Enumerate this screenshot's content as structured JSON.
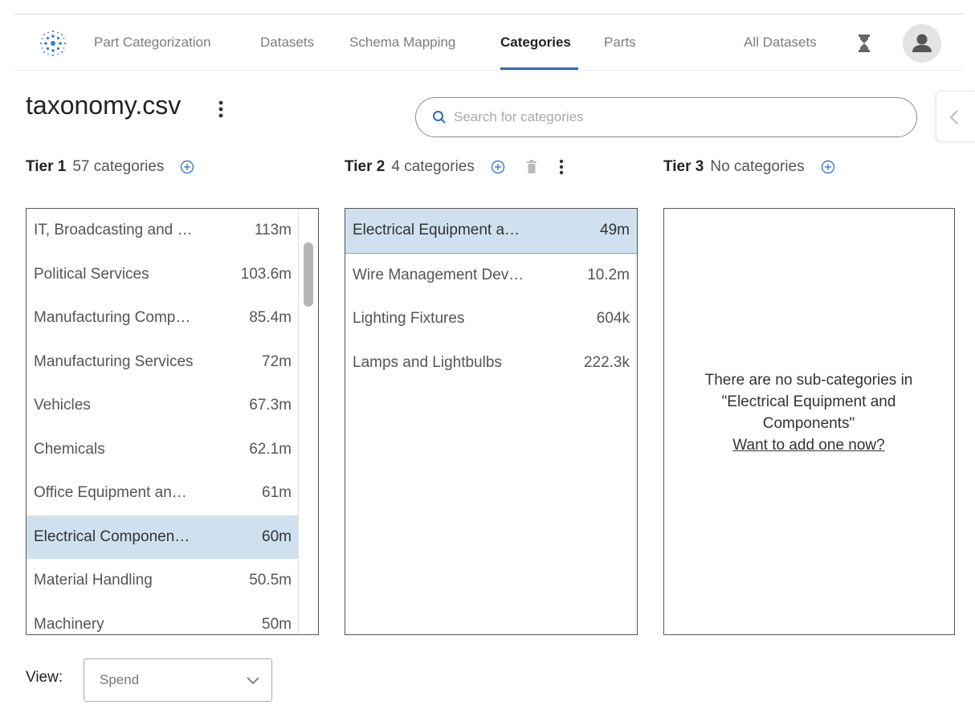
{
  "nav": {
    "items": [
      "Part Categorization",
      "Datasets",
      "Schema Mapping",
      "Categories",
      "Parts"
    ],
    "active": "Categories",
    "dataset_filter": "All Datasets",
    "accent_color": "#2a6fb4"
  },
  "page": {
    "title": "taxonomy.csv"
  },
  "search": {
    "placeholder": "Search for categories"
  },
  "tiers": [
    {
      "name": "Tier 1",
      "count_label": "57 categories",
      "rows": [
        {
          "label": "IT, Broadcasting and …",
          "value": "113m"
        },
        {
          "label": "Political Services",
          "value": "103.6m"
        },
        {
          "label": "Manufacturing Comp…",
          "value": "85.4m"
        },
        {
          "label": "Manufacturing Services",
          "value": "72m"
        },
        {
          "label": "Vehicles",
          "value": "67.3m"
        },
        {
          "label": "Chemicals",
          "value": "62.1m"
        },
        {
          "label": "Office Equipment an…",
          "value": "61m"
        },
        {
          "label": "Electrical Componen…",
          "value": "60m",
          "selected": true
        },
        {
          "label": "Material Handling",
          "value": "50.5m"
        },
        {
          "label": "Machinery",
          "value": "50m"
        }
      ]
    },
    {
      "name": "Tier 2",
      "count_label": "4 categories",
      "rows": [
        {
          "label": "Electrical Equipment a…",
          "value": "49m",
          "selected": true
        },
        {
          "label": "Wire Management Dev…",
          "value": "10.2m"
        },
        {
          "label": "Lighting Fixtures",
          "value": "604k"
        },
        {
          "label": "Lamps and Lightbulbs",
          "value": "222.3k"
        }
      ]
    },
    {
      "name": "Tier 3",
      "count_label": "No categories",
      "rows": []
    }
  ],
  "empty_state": {
    "line1": "There are no sub-categories in",
    "line2": "\"Electrical Equipment and",
    "line3": "Components\"",
    "link": "Want to add one now?"
  },
  "view": {
    "label": "View:",
    "selected": "Spend"
  },
  "icons": {
    "logo": "snowflake-logo-icon",
    "hourglass": "hourglass-icon",
    "avatar": "user-avatar-icon",
    "search": "search-icon",
    "add": "add-circle-icon",
    "delete": "trash-icon",
    "more": "kebab-menu-icon",
    "collapse": "chevron-left-icon",
    "dropdown": "chevron-down-icon"
  },
  "colors": {
    "selected_row": "#cfe1ee",
    "add_icon": "#3a7bc8"
  }
}
